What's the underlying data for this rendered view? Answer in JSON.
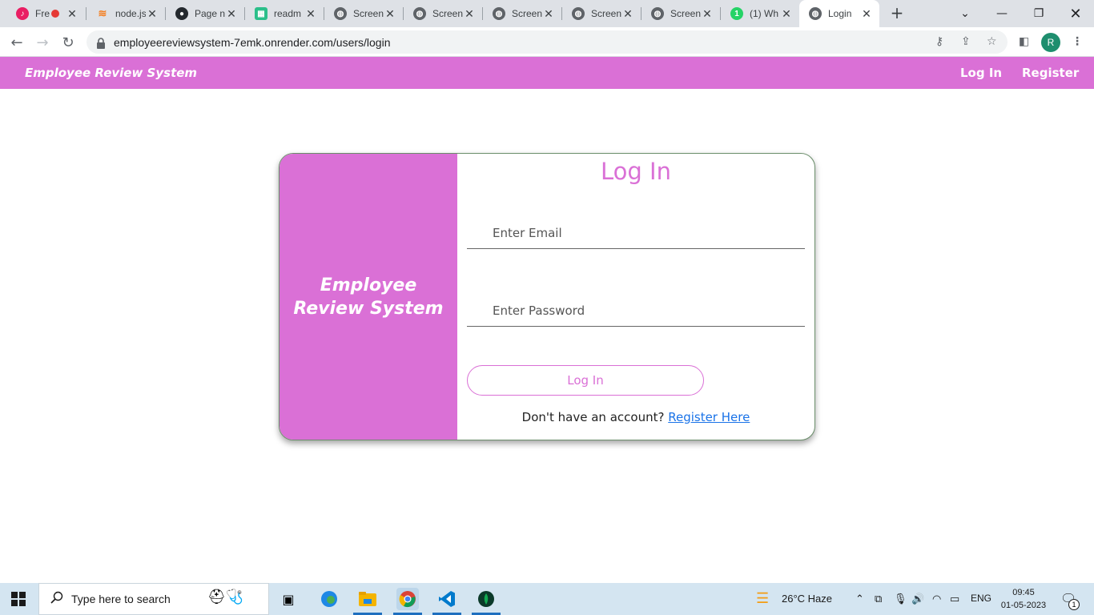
{
  "browser": {
    "tabs": [
      {
        "title": "Fre",
        "favicon": "music-icon",
        "color": "#e91e63"
      },
      {
        "title": "node.js",
        "favicon": "stackoverflow-icon",
        "color": "#f48024"
      },
      {
        "title": "Page n",
        "favicon": "github-icon",
        "color": "#24292e"
      },
      {
        "title": "readm",
        "favicon": "editor-icon",
        "color": "#2bbf8a"
      },
      {
        "title": "Screen",
        "favicon": "globe-icon",
        "color": "#5f6368"
      },
      {
        "title": "Screen",
        "favicon": "globe-icon",
        "color": "#5f6368"
      },
      {
        "title": "Screen",
        "favicon": "globe-icon",
        "color": "#5f6368"
      },
      {
        "title": "Screen",
        "favicon": "globe-icon",
        "color": "#5f6368"
      },
      {
        "title": "Screen",
        "favicon": "globe-icon",
        "color": "#5f6368"
      },
      {
        "title": "(1) Wh",
        "favicon": "whatsapp-icon",
        "color": "#25d366"
      },
      {
        "title": "Login",
        "favicon": "globe-icon",
        "color": "#5f6368",
        "active": true
      }
    ],
    "url": "employeereviewsystem-7emk.onrender.com/users/login",
    "profile_initial": "R"
  },
  "site": {
    "brand": "Employee Review System",
    "nav": {
      "login": "Log In",
      "register": "Register"
    },
    "accent_color": "#da70d6"
  },
  "login_card": {
    "side_title": "Employee Review System",
    "title": "Log In",
    "email_placeholder": "Enter Email",
    "password_placeholder": "Enter Password",
    "submit_label": "Log In",
    "register_prompt": "Don't have an account?",
    "register_link": "Register Here"
  },
  "taskbar": {
    "search_placeholder": "Type here to search",
    "weather": "26°C  Haze",
    "language": "ENG",
    "time": "09:45",
    "date": "01-05-2023",
    "notification_count": "1"
  }
}
